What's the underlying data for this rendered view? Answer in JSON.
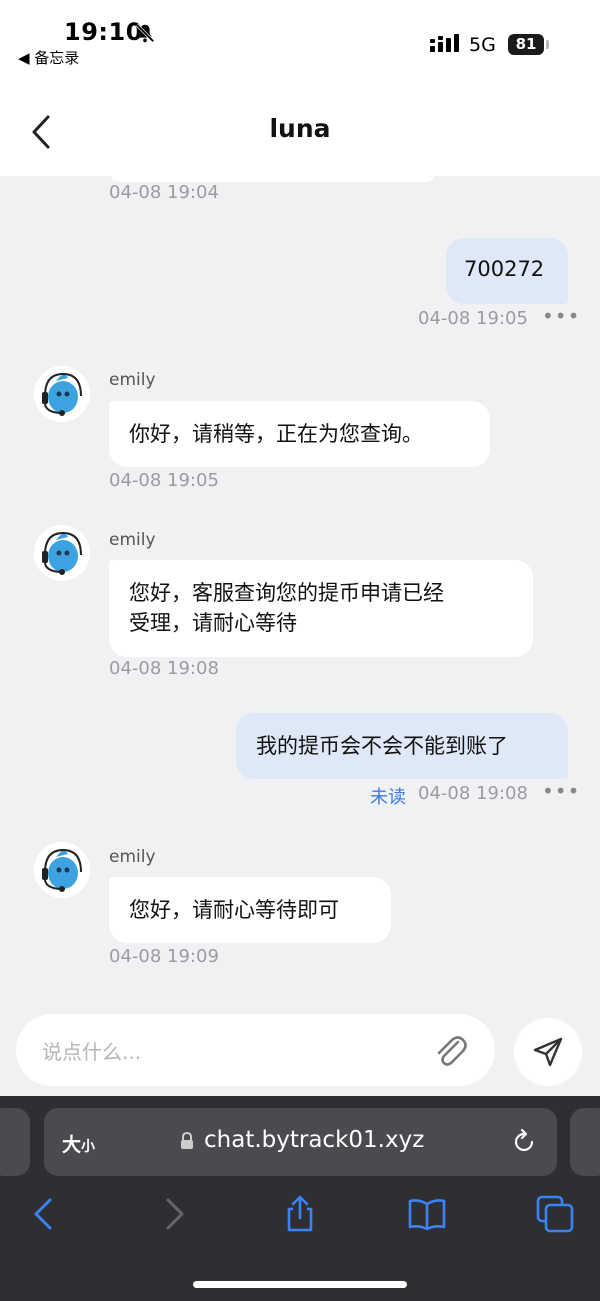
{
  "status_bar": {
    "time": "19:10",
    "back_app": "◀ 备忘录",
    "network": "5G",
    "battery": "81"
  },
  "header": {
    "title": "luna"
  },
  "messages": [
    {
      "direction": "in",
      "time": "04-08 19:04"
    },
    {
      "direction": "out",
      "text": "700272",
      "time": "04-08 19:05"
    },
    {
      "direction": "in",
      "sender": "emily",
      "text": "你好，请稍等，正在为您查询。",
      "time": "04-08 19:05"
    },
    {
      "direction": "in",
      "sender": "emily",
      "text_line1": "您好，客服查询您的提币申请已经",
      "text_line2": "受理，请耐心等待",
      "time": "04-08 19:08"
    },
    {
      "direction": "out",
      "text": "我的提币会不会不能到账了",
      "status": "未读",
      "time": "04-08 19:08"
    },
    {
      "direction": "in",
      "sender": "emily",
      "text": "您好，请耐心等待即可",
      "time": "04-08 19:09"
    }
  ],
  "composer": {
    "placeholder": "说点什么..."
  },
  "browser": {
    "text_size_big": "大",
    "text_size_small": "小",
    "url": "chat.bytrack01.xyz"
  },
  "colors": {
    "outgoing_bubble": "#dfe8f7",
    "incoming_bubble": "#ffffff",
    "unread": "#3a7bea",
    "toolbar_icon": "#3b82f6"
  },
  "icons": [
    "bell-slash-icon",
    "back-chevron-icon",
    "headset-avatar-icon",
    "paperclip-icon",
    "send-icon",
    "lock-icon",
    "reload-icon",
    "share-icon",
    "bookmarks-icon",
    "tabs-icon"
  ]
}
